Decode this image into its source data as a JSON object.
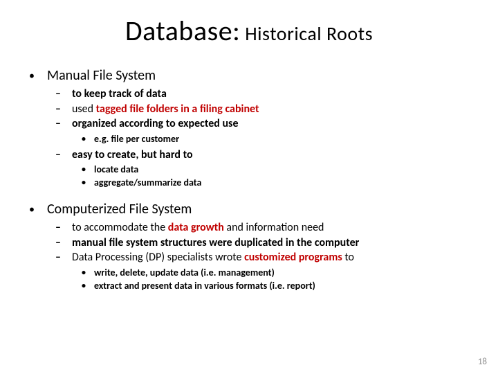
{
  "title": {
    "main": "Database:",
    "sub": " Historical Roots"
  },
  "sections": [
    {
      "heading": "Manual File System",
      "items": [
        {
          "plain": "to keep track of data"
        },
        {
          "pre": "used ",
          "accent": "tagged file folders in a filing cabinet"
        },
        {
          "plain": "organized according to expected use",
          "sub": [
            "e.g. file per customer"
          ]
        },
        {
          "plain": "easy to create, but hard to",
          "sub": [
            "locate data",
            "aggregate/summarize data"
          ]
        }
      ]
    },
    {
      "heading": "Computerized File System",
      "items": [
        {
          "pre": "to accommodate the ",
          "accent": "data growth",
          "post": " and information need"
        },
        {
          "plain": "manual file system structures were duplicated in the computer"
        },
        {
          "pre": "Data Processing (DP) specialists wrote ",
          "accent": "customized programs",
          "post": " to",
          "sub": [
            "write, delete, update data (i.e. management)",
            "extract and present data in various formats (i.e. report)"
          ]
        }
      ]
    }
  ],
  "pageNumber": "18"
}
